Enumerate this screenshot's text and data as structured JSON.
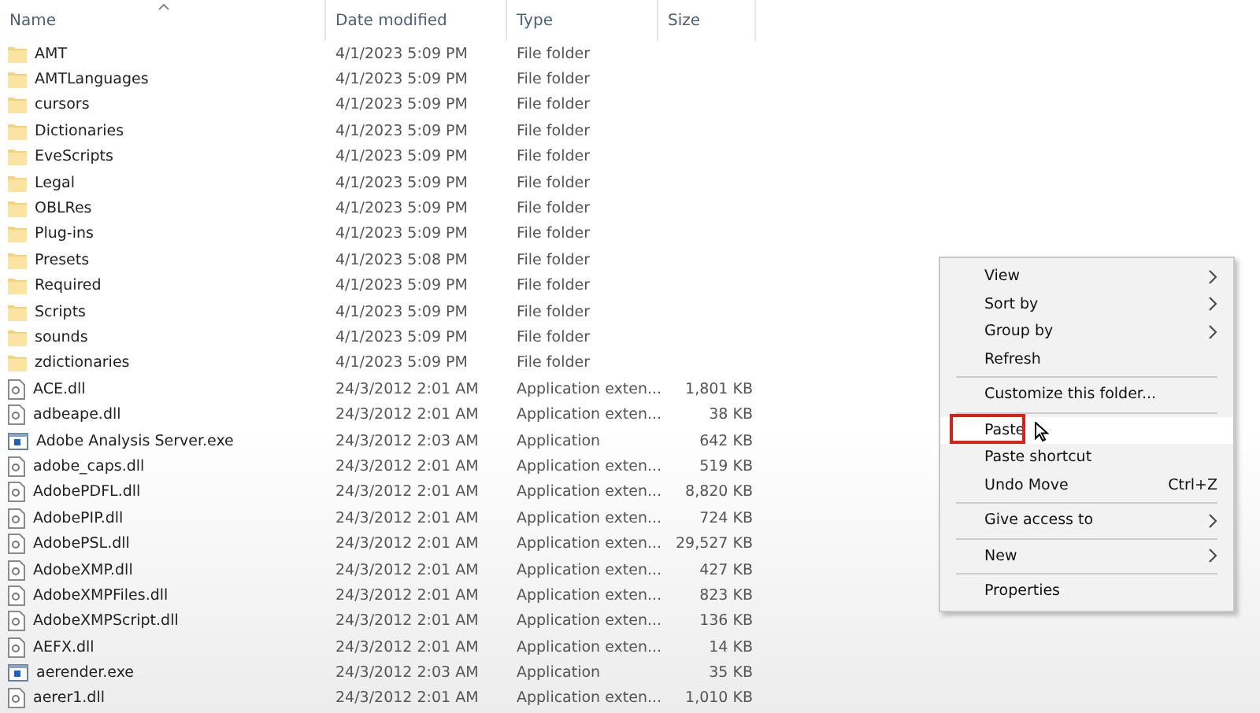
{
  "columns": [
    {
      "label": "Name",
      "sorted": true
    },
    {
      "label": "Date modified",
      "sorted": false
    },
    {
      "label": "Type",
      "sorted": false
    },
    {
      "label": "Size",
      "sorted": false
    }
  ],
  "rows": [
    {
      "kind": "folder",
      "name": "AMT",
      "date": "4/1/2023 5:09 PM",
      "type": "File folder"
    },
    {
      "kind": "folder",
      "name": "AMTLanguages",
      "date": "4/1/2023 5:09 PM",
      "type": "File folder"
    },
    {
      "kind": "folder",
      "name": "cursors",
      "date": "4/1/2023 5:09 PM",
      "type": "File folder"
    },
    {
      "kind": "folder",
      "name": "Dictionaries",
      "date": "4/1/2023 5:09 PM",
      "type": "File folder"
    },
    {
      "kind": "folder",
      "name": "EveScripts",
      "date": "4/1/2023 5:09 PM",
      "type": "File folder"
    },
    {
      "kind": "folder",
      "name": "Legal",
      "date": "4/1/2023 5:09 PM",
      "type": "File folder"
    },
    {
      "kind": "folder",
      "name": "OBLRes",
      "date": "4/1/2023 5:09 PM",
      "type": "File folder"
    },
    {
      "kind": "folder",
      "name": "Plug-ins",
      "date": "4/1/2023 5:09 PM",
      "type": "File folder"
    },
    {
      "kind": "folder",
      "name": "Presets",
      "date": "4/1/2023 5:08 PM",
      "type": "File folder"
    },
    {
      "kind": "folder",
      "name": "Required",
      "date": "4/1/2023 5:09 PM",
      "type": "File folder"
    },
    {
      "kind": "folder",
      "name": "Scripts",
      "date": "4/1/2023 5:09 PM",
      "type": "File folder"
    },
    {
      "kind": "folder",
      "name": "sounds",
      "date": "4/1/2023 5:09 PM",
      "type": "File folder"
    },
    {
      "kind": "folder",
      "name": "zdictionaries",
      "date": "4/1/2023 5:09 PM",
      "type": "File folder"
    },
    {
      "kind": "dll",
      "name": "ACE.dll",
      "date": "24/3/2012 2:01 AM",
      "type": "Application exten...",
      "size": "1,801 KB"
    },
    {
      "kind": "dll",
      "name": "adbeape.dll",
      "date": "24/3/2012 2:01 AM",
      "type": "Application exten...",
      "size": "38 KB"
    },
    {
      "kind": "exe",
      "name": "Adobe Analysis Server.exe",
      "date": "24/3/2012 2:03 AM",
      "type": "Application",
      "size": "642 KB"
    },
    {
      "kind": "dll",
      "name": "adobe_caps.dll",
      "date": "24/3/2012 2:01 AM",
      "type": "Application exten...",
      "size": "519 KB"
    },
    {
      "kind": "dll",
      "name": "AdobePDFL.dll",
      "date": "24/3/2012 2:01 AM",
      "type": "Application exten...",
      "size": "8,820 KB"
    },
    {
      "kind": "dll",
      "name": "AdobePIP.dll",
      "date": "24/3/2012 2:01 AM",
      "type": "Application exten...",
      "size": "724 KB"
    },
    {
      "kind": "dll",
      "name": "AdobePSL.dll",
      "date": "24/3/2012 2:01 AM",
      "type": "Application exten...",
      "size": "29,527 KB"
    },
    {
      "kind": "dll",
      "name": "AdobeXMP.dll",
      "date": "24/3/2012 2:01 AM",
      "type": "Application exten...",
      "size": "427 KB"
    },
    {
      "kind": "dll",
      "name": "AdobeXMPFiles.dll",
      "date": "24/3/2012 2:01 AM",
      "type": "Application exten...",
      "size": "823 KB"
    },
    {
      "kind": "dll",
      "name": "AdobeXMPScript.dll",
      "date": "24/3/2012 2:01 AM",
      "type": "Application exten...",
      "size": "136 KB"
    },
    {
      "kind": "dll",
      "name": "AEFX.dll",
      "date": "24/3/2012 2:01 AM",
      "type": "Application exten...",
      "size": "14 KB"
    },
    {
      "kind": "exe",
      "name": "aerender.exe",
      "date": "24/3/2012 2:03 AM",
      "type": "Application",
      "size": "35 KB"
    },
    {
      "kind": "dll",
      "name": "aerer1.dll",
      "date": "24/3/2012 2:01 AM",
      "type": "Application exten...",
      "size": "1,010 KB"
    }
  ],
  "context_menu": [
    {
      "kind": "item",
      "label": "View",
      "submenu": true,
      "selected": false
    },
    {
      "kind": "item",
      "label": "Sort by",
      "submenu": true,
      "selected": false
    },
    {
      "kind": "item",
      "label": "Group by",
      "submenu": true,
      "selected": false
    },
    {
      "kind": "item",
      "label": "Refresh",
      "submenu": false,
      "selected": false
    },
    {
      "kind": "separator"
    },
    {
      "kind": "item",
      "label": "Customize this folder...",
      "submenu": false,
      "selected": false
    },
    {
      "kind": "separator"
    },
    {
      "kind": "item",
      "label": "Paste",
      "submenu": false,
      "selected": true
    },
    {
      "kind": "item",
      "label": "Paste shortcut",
      "submenu": false,
      "selected": false
    },
    {
      "kind": "item",
      "label": "Undo Move",
      "shortcut": "Ctrl+Z",
      "submenu": false,
      "selected": false
    },
    {
      "kind": "separator"
    },
    {
      "kind": "item",
      "label": "Give access to",
      "submenu": true,
      "selected": false
    },
    {
      "kind": "separator"
    },
    {
      "kind": "item",
      "label": "New",
      "submenu": true,
      "selected": false
    },
    {
      "kind": "separator"
    },
    {
      "kind": "item",
      "label": "Properties",
      "submenu": false,
      "selected": false
    }
  ]
}
